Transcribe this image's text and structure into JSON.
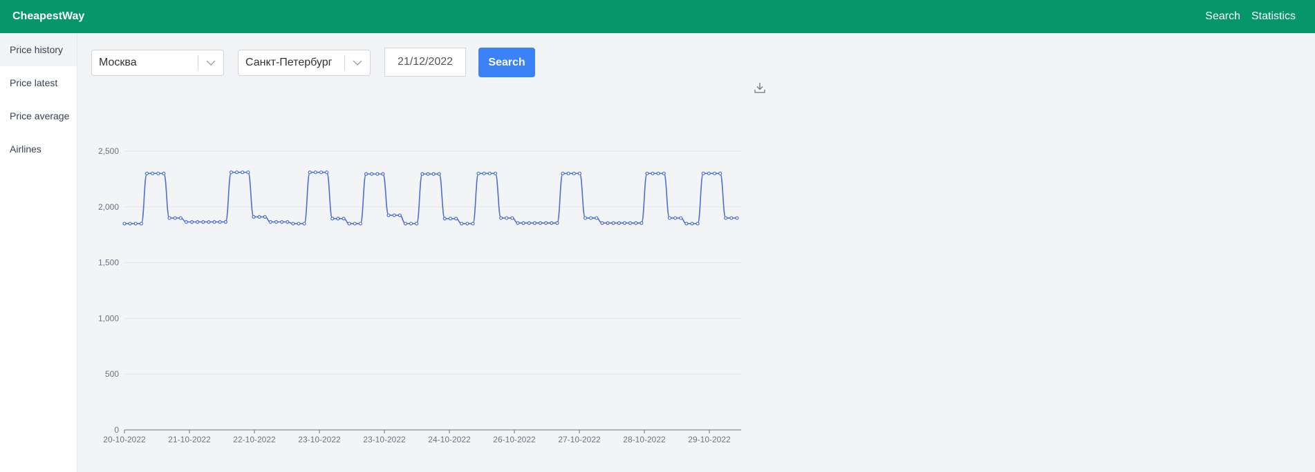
{
  "app": {
    "brand": "CheapestWay"
  },
  "topnav": {
    "search": "Search",
    "statistics": "Statistics"
  },
  "sidebar": {
    "items": [
      {
        "label": "Price history"
      },
      {
        "label": "Price latest"
      },
      {
        "label": "Price average"
      },
      {
        "label": "Airlines"
      }
    ]
  },
  "filters": {
    "origin": "Москва",
    "destination": "Санкт-Петербург",
    "date": "21/12/2022",
    "search_label": "Search"
  },
  "colors": {
    "topbar": "#079669",
    "search_button": "#3b82f6",
    "series_line": "#4a6fd1"
  },
  "icons": {
    "download": "download-icon",
    "chevron": "chevron-down-icon"
  },
  "chart_data": {
    "type": "line",
    "title": "",
    "xlabel": "",
    "ylabel": "",
    "ylim": [
      0,
      2500
    ],
    "yticks": [
      0,
      500,
      1000,
      1500,
      2000,
      2500
    ],
    "ytick_labels": [
      "0",
      "500",
      "1,000",
      "1,500",
      "2,000",
      "2,500"
    ],
    "x_labels": [
      "20-10-2022",
      "21-10-2022",
      "22-10-2022",
      "23-10-2022",
      "23-10-2022",
      "24-10-2022",
      "26-10-2022",
      "27-10-2022",
      "28-10-2022",
      "29-10-2022"
    ],
    "grid": true,
    "series": [
      {
        "values": [
          1850,
          1850,
          1850,
          1850,
          2300,
          2300,
          2300,
          2300,
          1900,
          1900,
          1900,
          1865,
          1865,
          1865,
          1865,
          1865,
          1865,
          1865,
          1865,
          2310,
          2310,
          2310,
          2310,
          1910,
          1910,
          1910,
          1865,
          1865,
          1865,
          1865,
          1850,
          1850,
          1850,
          2310,
          2310,
          2310,
          2310,
          1895,
          1895,
          1895,
          1850,
          1850,
          1850,
          2295,
          2295,
          2295,
          2295,
          1925,
          1925,
          1925,
          1850,
          1850,
          1850,
          2295,
          2295,
          2295,
          2295,
          1895,
          1895,
          1895,
          1850,
          1850,
          1850,
          2300,
          2300,
          2300,
          2300,
          1900,
          1900,
          1900,
          1855,
          1855,
          1855,
          1855,
          1855,
          1855,
          1855,
          1855,
          2300,
          2300,
          2300,
          2300,
          1900,
          1900,
          1900,
          1855,
          1855,
          1855,
          1855,
          1855,
          1855,
          1855,
          1855,
          2300,
          2300,
          2300,
          2300,
          1900,
          1900,
          1900,
          1850,
          1850,
          1850,
          2300,
          2300,
          2300,
          2300,
          1900,
          1900,
          1900
        ]
      }
    ]
  }
}
